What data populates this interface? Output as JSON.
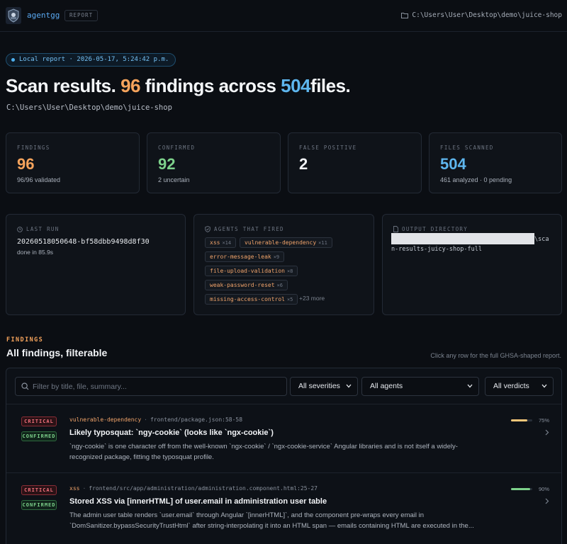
{
  "app": {
    "brand": "agentgg",
    "badge": "REPORT",
    "project_path": "C:\\Users\\User\\Desktop\\demo\\juice-shop"
  },
  "hero": {
    "pill": "Local report · 2026-05-17, 5:24:42 p.m.",
    "title_prefix": "Scan results.",
    "findings_count": "96",
    "title_mid": "findings across",
    "files_count": "504",
    "title_suffix": "files.",
    "path": "C:\\Users\\User\\Desktop\\demo\\juice-shop"
  },
  "stats": [
    {
      "label": "FINDINGS",
      "value": "96",
      "sub": "96/96 validated",
      "color": "#f5a35c"
    },
    {
      "label": "CONFIRMED",
      "value": "92",
      "sub": "2 uncertain",
      "color": "#7dd18b"
    },
    {
      "label": "FALSE POSITIVE",
      "value": "2",
      "sub": "",
      "color": "#f1f3f6"
    },
    {
      "label": "FILES SCANNED",
      "value": "504",
      "sub": "461 analyzed · 0 pending",
      "color": "#5eb6ee"
    }
  ],
  "last_run": {
    "label": "LAST RUN",
    "id": "20260518050648-bf58dbb9498d8f30",
    "done": "done in 85.9s"
  },
  "agents": {
    "label": "AGENTS THAT FIRED",
    "items": [
      {
        "name": "xss",
        "count": "×14"
      },
      {
        "name": "vulnerable-dependency",
        "count": "×11"
      },
      {
        "name": "error-message-leak",
        "count": "×9"
      },
      {
        "name": "file-upload-validation",
        "count": "×8"
      },
      {
        "name": "weak-password-reset",
        "count": "×6"
      },
      {
        "name": "missing-access-control",
        "count": "×5"
      }
    ],
    "more": "+23 more"
  },
  "output": {
    "label": "OUTPUT DIRECTORY",
    "tail": "\\sca",
    "line2": "n-results-juicy-shop-full"
  },
  "findings_section": {
    "eyebrow": "FINDINGS",
    "title": "All findings, filterable",
    "hint": "Click any row for the full GHSA-shaped report."
  },
  "filters": {
    "search_placeholder": "Filter by title, file, summary...",
    "severity": "All severities",
    "agent": "All agents",
    "verdict": "All verdicts"
  },
  "rows": [
    {
      "severity": "CRITICAL",
      "verdict": "CONFIRMED",
      "agent": "vulnerable-dependency",
      "file": "frontend/package.json:58-58",
      "title": "Likely typosquat: `ngy-cookie` (looks like `ngx-cookie`)",
      "desc1": "`ngy-cookie` is one character off from the well-known `ngx-cookie` / `ngx-cookie-service` Angular libraries and is not itself a widely-",
      "desc2": "recognized package, fitting the typosquat profile.",
      "confidence": "75%",
      "confidence_value": 0.75,
      "bar_color": "#f5c77a"
    },
    {
      "severity": "CRITICAL",
      "verdict": "CONFIRMED",
      "agent": "xss",
      "file": "frontend/src/app/administration/administration.component.html:25-27",
      "title": "Stored XSS via [innerHTML] of user.email in administration user table",
      "desc1": "The admin user table renders `user.email` through Angular `[innerHTML]`, and the component pre-wraps every email in",
      "desc2": "`DomSanitizer.bypassSecurityTrustHtml` after string-interpolating it into an HTML span — emails containing HTML are executed in the...",
      "confidence": "90%",
      "confidence_value": 0.9,
      "bar_color": "#7dd18b"
    }
  ]
}
